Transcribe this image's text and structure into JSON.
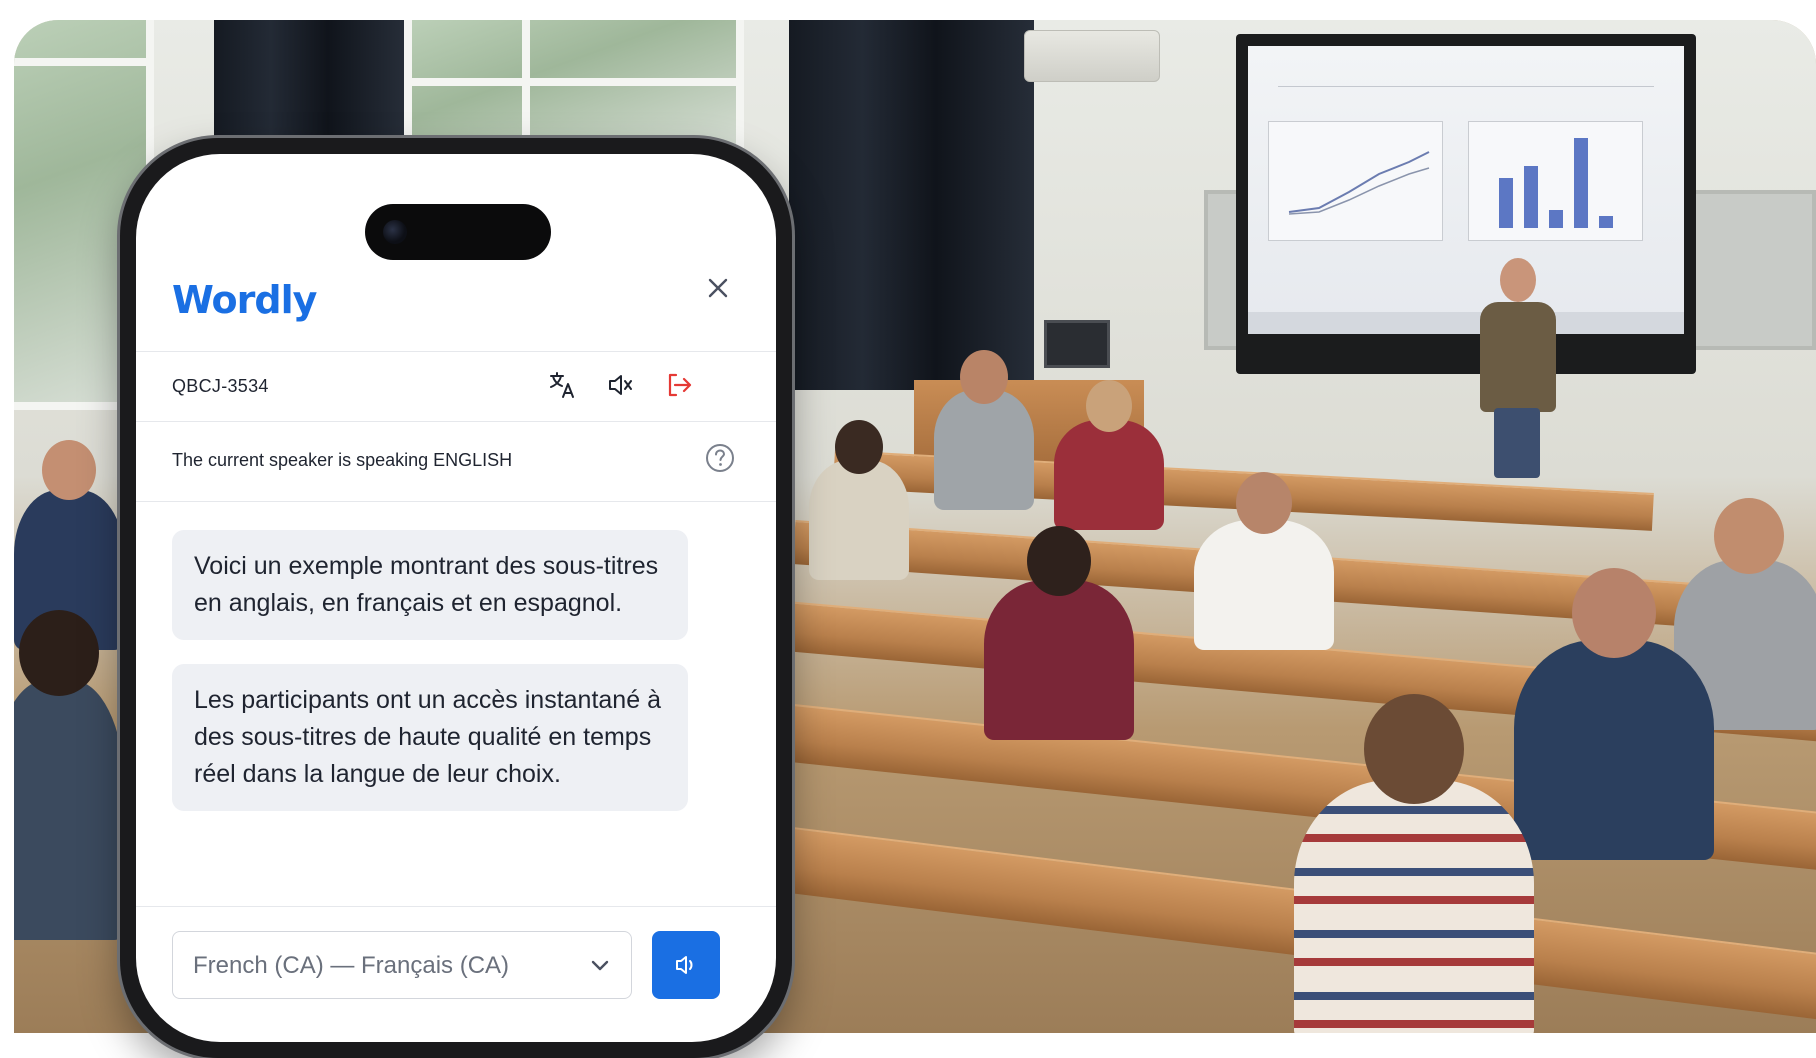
{
  "app": {
    "logo_text": "Wordly",
    "brand_color": "#1a6fe3",
    "exit_color": "#e53935"
  },
  "header": {
    "close_icon": "close-icon"
  },
  "toolbar": {
    "session_code": "QBCJ-3534",
    "icons": [
      "translate-icon",
      "mute-icon",
      "exit-icon"
    ]
  },
  "speaker": {
    "status_text": "The current speaker is speaking ENGLISH",
    "help_icon": "help-icon"
  },
  "transcript": {
    "messages": [
      {
        "text": "Voici un exemple montrant des sous-titres en anglais, en français et en espagnol."
      },
      {
        "text": "Les participants ont un accès instantané à des sous-titres de haute qualité en temps réel dans la langue de leur choix."
      }
    ]
  },
  "bottom": {
    "language_value": "French (CA) — Français (CA)",
    "audio_button_icon": "speaker-icon"
  }
}
